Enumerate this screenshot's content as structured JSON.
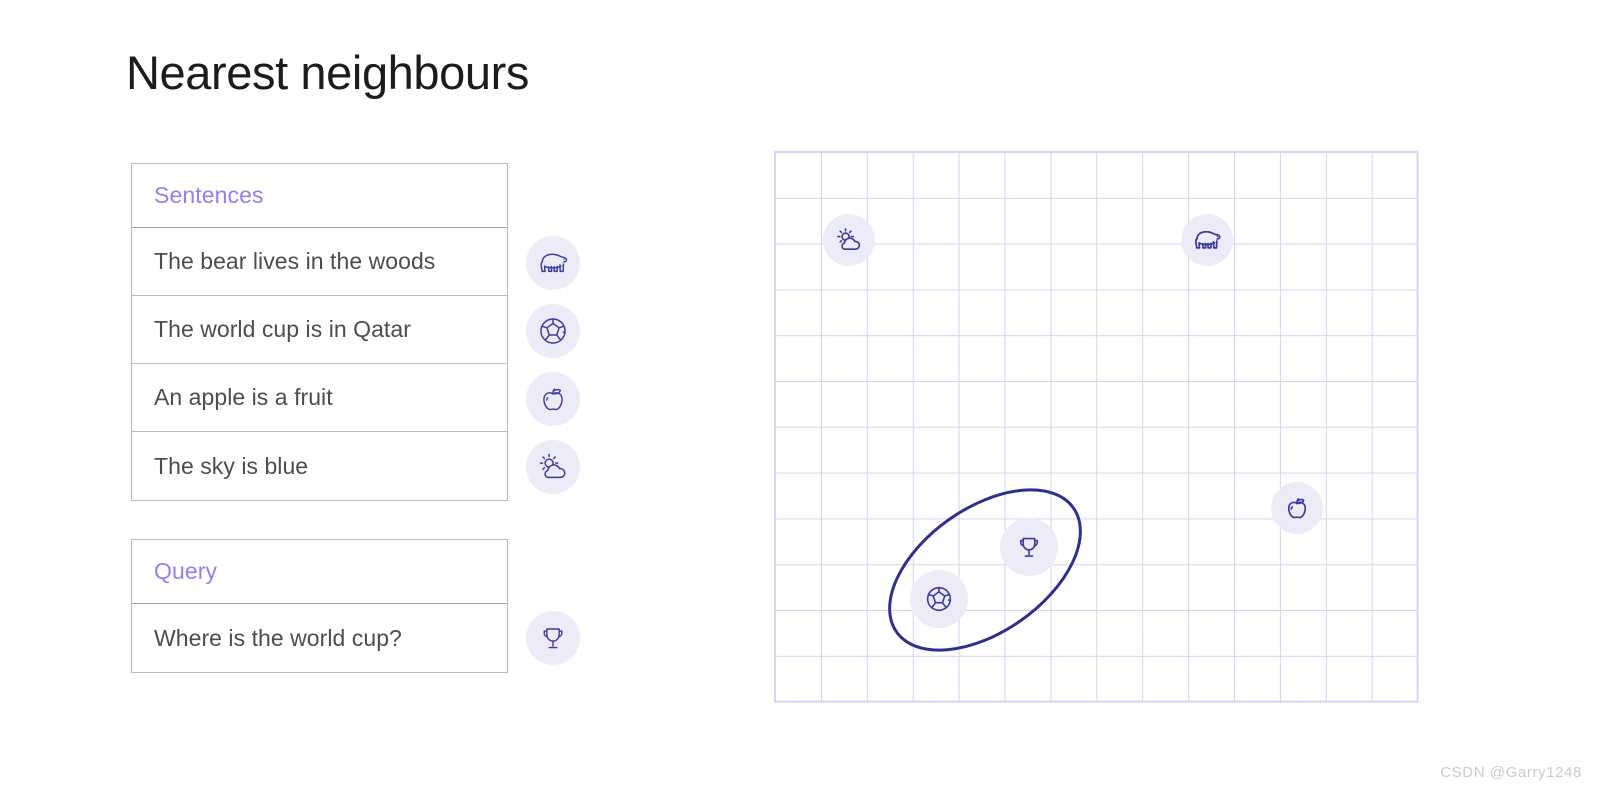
{
  "page": {
    "title": "Nearest neighbours",
    "background": "#ffffff",
    "watermark": "CSDN @Garry1248"
  },
  "colors": {
    "accent_purple": "#8f82f0",
    "icon_stroke": "#3b3b9e",
    "icon_chip_bg": "#edebf8",
    "grid_line": "#d7d2f7",
    "ellipse_stroke": "#2f2f8f",
    "table_border": "#b9bcc0",
    "row_text": "#4a4d52",
    "title_text": "#1b1c1e",
    "watermark_text": "#c9cace"
  },
  "sentences_table": {
    "header": "Sentences",
    "rows": [
      {
        "text": "The bear lives in the woods",
        "icon": "bear-icon"
      },
      {
        "text": "The world cup is in Qatar",
        "icon": "soccer-ball-icon"
      },
      {
        "text": "An apple is a fruit",
        "icon": "apple-icon"
      },
      {
        "text": "The sky is blue",
        "icon": "sun-cloud-icon"
      }
    ]
  },
  "query_table": {
    "header": "Query",
    "rows": [
      {
        "text": "Where is the world cup?",
        "icon": "trophy-icon"
      }
    ]
  },
  "chart_data": {
    "type": "scatter",
    "title": "Nearest neighbours",
    "xlabel": "",
    "ylabel": "",
    "grid": true,
    "legend": "none",
    "axis_labels_shown": false,
    "grid_columns": 14,
    "grid_rows": 12,
    "xlim": [
      0,
      14
    ],
    "ylim": [
      0,
      12
    ],
    "points": [
      {
        "label": "The sky is blue",
        "icon": "sun-cloud-icon",
        "x": 1.6,
        "y": 10.1
      },
      {
        "label": "The bear lives in the woods",
        "icon": "bear-icon",
        "x": 9.4,
        "y": 10.1
      },
      {
        "label": "An apple is a fruit",
        "icon": "apple-icon",
        "x": 11.4,
        "y": 4.2
      },
      {
        "label": "Where is the world cup?",
        "icon": "trophy-icon",
        "x": 5.5,
        "y": 3.3
      },
      {
        "label": "The world cup is in Qatar",
        "icon": "soccer-ball-icon",
        "x": 3.6,
        "y": 2.2
      }
    ],
    "annotations": [
      {
        "type": "ellipse",
        "name": "nearest-neighbour-cluster",
        "center_x": 4.55,
        "center_y": 2.75,
        "radius_x": 2.35,
        "radius_y": 1.35,
        "rotation_deg": -35,
        "encloses": [
          "The world cup is in Qatar",
          "Where is the world cup?"
        ]
      }
    ]
  }
}
